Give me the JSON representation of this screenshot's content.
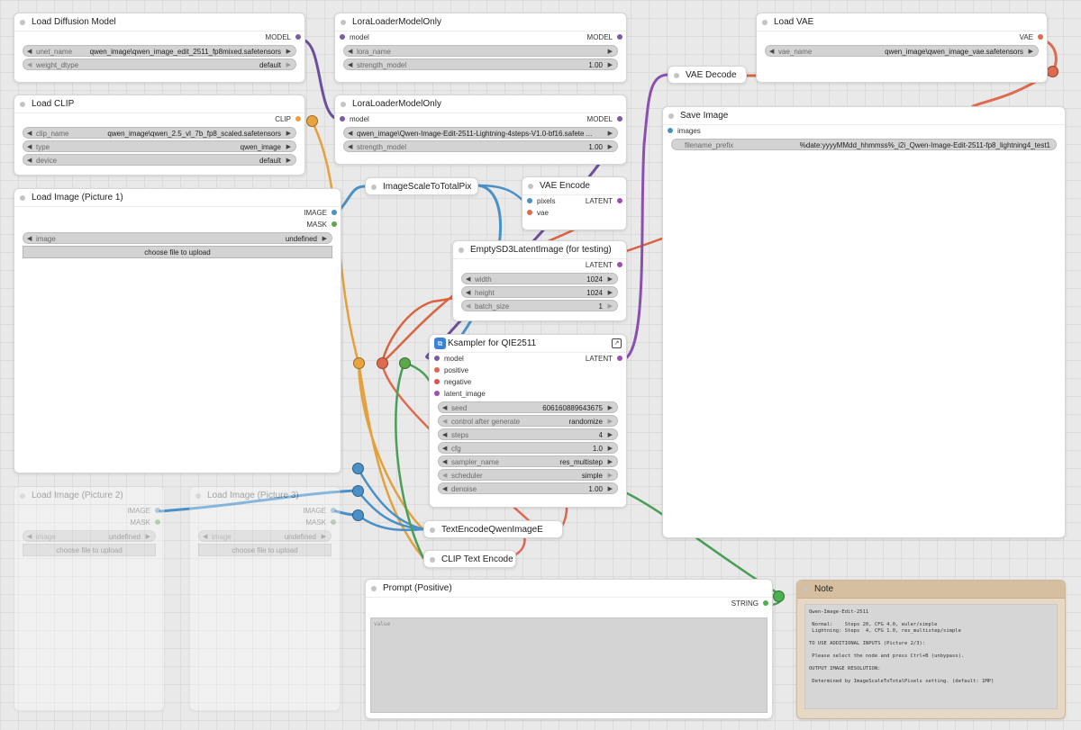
{
  "colors": {
    "model": "#7b5aa6",
    "clip": "#e8a33d",
    "vae": "#e06a4e",
    "image": "#4a90c8",
    "mask": "#5aa84a",
    "latent": "#a04fb0",
    "conditioning_pos": "#e0644f",
    "conditioning_neg": "#d95454",
    "string": "#4caf50",
    "note_bg": "#e6d8c4"
  },
  "nodes": {
    "load_diffusion_model": {
      "title": "Load Diffusion Model",
      "output": "MODEL",
      "widgets": [
        {
          "name": "unet_name",
          "value": "qwen_image\\qwen_image_edit_2511_fp8mixed.safetensors"
        },
        {
          "name": "weight_dtype",
          "value": "default"
        }
      ]
    },
    "lora_loader_1": {
      "title": "LoraLoaderModelOnly",
      "input": "model",
      "output": "MODEL",
      "widgets": [
        {
          "name": "lora_name",
          "value": ""
        },
        {
          "name": "strength_model",
          "value": "1.00"
        }
      ]
    },
    "lora_loader_2": {
      "title": "LoraLoaderModelOnly",
      "input": "model",
      "output": "MODEL",
      "widgets": [
        {
          "name": "",
          "value": "qwen_image\\Qwen-Image-Edit-2511-Lightning-4steps-V1.0-bf16.safete ..."
        },
        {
          "name": "strength_model",
          "value": "1.00"
        }
      ]
    },
    "load_clip": {
      "title": "Load CLIP",
      "output": "CLIP",
      "widgets": [
        {
          "name": "clip_name",
          "value": "qwen_image\\qwen_2.5_vl_7b_fp8_scaled.safetensors"
        },
        {
          "name": "type",
          "value": "qwen_image"
        },
        {
          "name": "device",
          "value": "default"
        }
      ]
    },
    "load_vae": {
      "title": "Load VAE",
      "output": "VAE",
      "widgets": [
        {
          "name": "vae_name",
          "value": "qwen_image\\qwen_image_vae.safetensors"
        }
      ]
    },
    "vae_decode": {
      "title": "VAE Decode"
    },
    "save_image": {
      "title": "Save Image",
      "input": "images",
      "widgets": [
        {
          "name": "filename_prefix",
          "value": "%date:yyyyMMdd_hhmmss%_i2i_Qwen-Image-Edit-2511-fp8_lightning4_test1"
        }
      ]
    },
    "load_image_1": {
      "title": "Load Image (Picture 1)",
      "outputs": [
        "IMAGE",
        "MASK"
      ],
      "widgets": [
        {
          "name": "image",
          "value": "undefined"
        }
      ],
      "button": "choose file to upload"
    },
    "load_image_2": {
      "title": "Load Image (Picture 2)",
      "outputs": [
        "IMAGE",
        "MASK"
      ],
      "widgets": [
        {
          "name": "image",
          "value": "undefined"
        }
      ],
      "button": "choose file to upload"
    },
    "load_image_3": {
      "title": "Load Image (Picture 3)",
      "outputs": [
        "IMAGE",
        "MASK"
      ],
      "widgets": [
        {
          "name": "image",
          "value": "undefined"
        }
      ],
      "button": "choose file to upload"
    },
    "image_scale": {
      "title": "ImageScaleToTotalPix"
    },
    "vae_encode": {
      "title": "VAE Encode",
      "inputs": [
        "pixels",
        "vae"
      ],
      "output": "LATENT"
    },
    "empty_latent": {
      "title": "EmptySD3LatentImage (for testing)",
      "output": "LATENT",
      "widgets": [
        {
          "name": "width",
          "value": "1024"
        },
        {
          "name": "height",
          "value": "1024"
        },
        {
          "name": "batch_size",
          "value": "1"
        }
      ]
    },
    "ksampler": {
      "title": "Ksampler for QIE2511",
      "inputs": [
        "model",
        "positive",
        "negative",
        "latent_image"
      ],
      "output": "LATENT",
      "widgets": [
        {
          "name": "seed",
          "value": "606160889643675"
        },
        {
          "name": "control after generate",
          "value": "randomize"
        },
        {
          "name": "steps",
          "value": "4"
        },
        {
          "name": "cfg",
          "value": "1.0"
        },
        {
          "name": "sampler_name",
          "value": "res_multistep"
        },
        {
          "name": "scheduler",
          "value": "simple"
        },
        {
          "name": "denoise",
          "value": "1.00"
        }
      ]
    },
    "text_encode_qwen": {
      "title": "TextEncodeQwenImageE"
    },
    "clip_text_encode": {
      "title": "CLIP Text Encode"
    },
    "prompt_positive": {
      "title": "Prompt (Positive)",
      "output": "STRING",
      "placeholder": "value"
    },
    "note": {
      "title": "Note",
      "text": "Qwen-Image-Edit-2511\n\n Normal:    Steps 20, CFG 4.0, euler/simple\n Lightning: Steps  4, CFG 1.0, res_multistep/simple\n\nTO USE ADDITIONAL INPUTS (Picture 2/3):\n\n Please select the node and press Ctrl+B (unbypass).\n\nOUTPUT IMAGE RESOLUTION:\n\n Determined by ImageScaleToTotalPixels setting. (default: 1MP)"
    }
  }
}
